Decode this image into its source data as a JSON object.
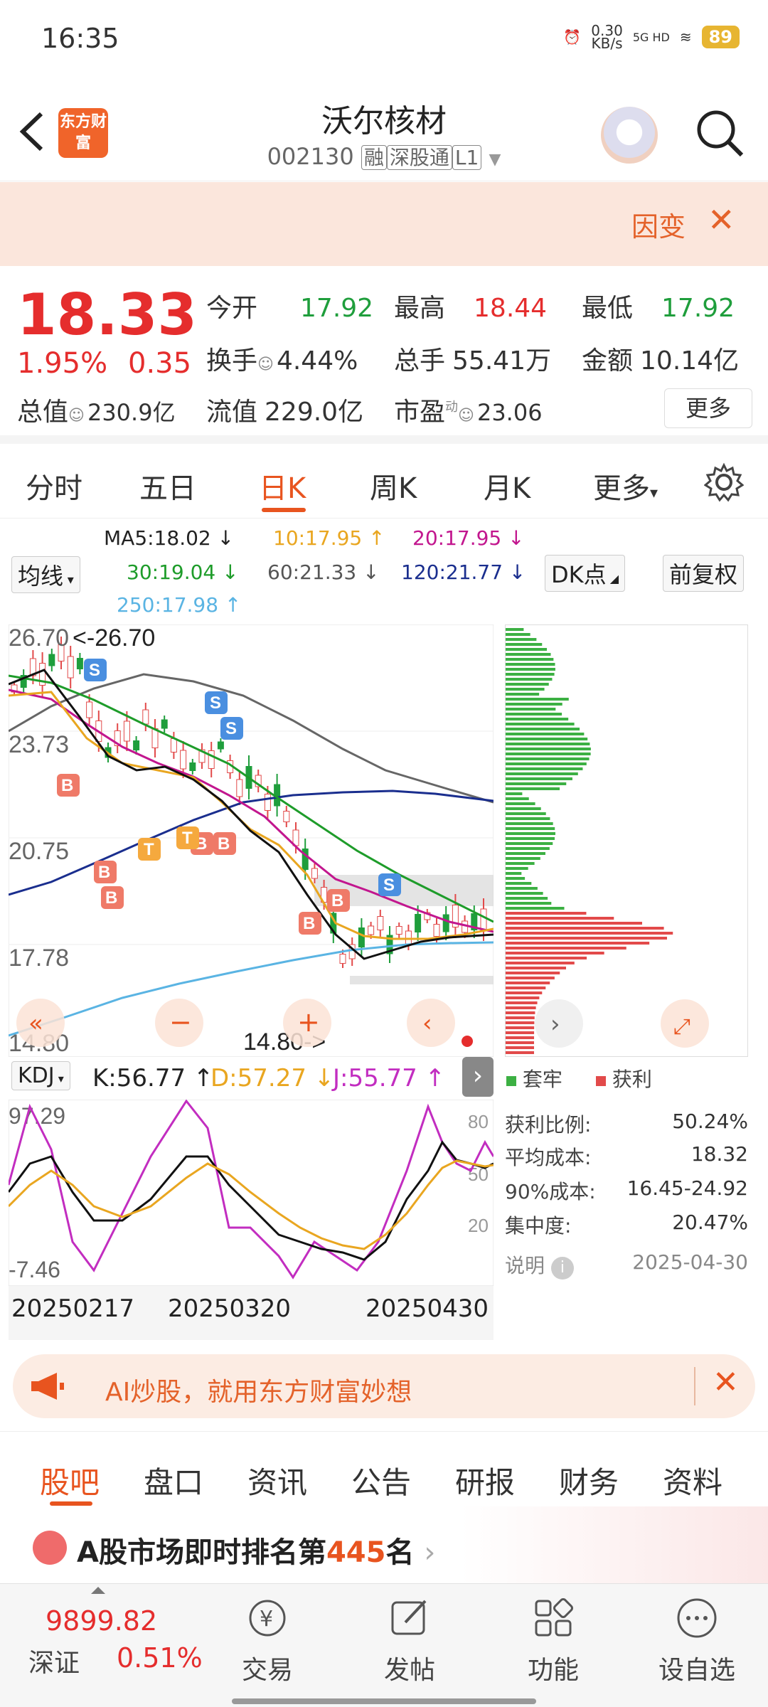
{
  "status_bar": {
    "time": "16:35",
    "net_speed": "0.30",
    "net_unit": "KB/s",
    "net_type": "5G HD",
    "battery": "89"
  },
  "header": {
    "logo_text": "东方财富",
    "title": "沃尔核材",
    "code": "002130",
    "tag_rong": "融",
    "tag_sgt": "深股通",
    "tag_l1": "L1"
  },
  "banner": {
    "text": "因变",
    "close": "✕"
  },
  "quote": {
    "price": "18.33",
    "pct": "1.95%",
    "change": "0.35",
    "open_label": "今开",
    "open": "17.92",
    "high_label": "最高",
    "high": "18.44",
    "low_label": "最低",
    "low": "17.92",
    "turnover_label": "换手",
    "turnover": "4.44%",
    "volume_label": "总手",
    "volume": "55.41万",
    "amount_label": "金额",
    "amount": "10.14亿",
    "mktcap_label": "总值",
    "mktcap": "230.9亿",
    "float_label": "流值",
    "float": "229.0亿",
    "pe_label": "市盈",
    "pe_sup": "动",
    "pe": "23.06",
    "more": "更多"
  },
  "tabs": [
    "分时",
    "五日",
    "日K",
    "周K",
    "月K",
    "更多"
  ],
  "ma": {
    "ma_select": "均线",
    "ma5": "MA5:18.02 ↓",
    "ma10": "10:17.95 ↑",
    "ma20": "20:17.95 ↓",
    "ma30": "30:19.04 ↓",
    "ma60": "60:21.33 ↓",
    "ma120": "120:21.77 ↓",
    "ma250": "250:17.98 ↑",
    "dk": "DK点",
    "adjust": "前复权"
  },
  "chart_data": {
    "type": "candlestick",
    "y_ticks": [
      "26.70",
      "23.73",
      "20.75",
      "17.78",
      "14.80"
    ],
    "max_label": "26.70",
    "min_label": "14.80",
    "ylim": [
      14.8,
      26.7
    ],
    "kdj": {
      "select": "KDJ",
      "k": "K:56.77 ↑",
      "d": "D:57.27 ↓",
      "j": "J:55.77 ↑",
      "y_top": "97.29",
      "y_bottom": "-7.46",
      "ref80": "80",
      "ref50": "50",
      "ref20": "20"
    },
    "x_ticks": [
      "20250217",
      "20250320",
      "20250430"
    ]
  },
  "chip": {
    "legend_locked": "套牢",
    "legend_profit": "获利",
    "rows": [
      {
        "label": "获利比例:",
        "value": "50.24%"
      },
      {
        "label": "平均成本:",
        "value": "18.32"
      },
      {
        "label": "90%成本:",
        "value": "16.45-24.92"
      },
      {
        "label": "集中度:",
        "value": "20.47%"
      }
    ],
    "note_label": "说明",
    "date": "2025-04-30"
  },
  "ai_banner": {
    "text": "AI炒股，就用东方财富妙想"
  },
  "bottom_tabs": [
    "股吧",
    "盘口",
    "资讯",
    "公告",
    "研报",
    "财务",
    "资料"
  ],
  "rank": {
    "prefix": "A股市场即时排名第",
    "num": "445",
    "suffix": "名"
  },
  "navbar": {
    "index_value": "9899.82",
    "index_name": "深证",
    "index_pct": "0.51%",
    "items": [
      "交易",
      "发帖",
      "功能",
      "设自选"
    ]
  }
}
